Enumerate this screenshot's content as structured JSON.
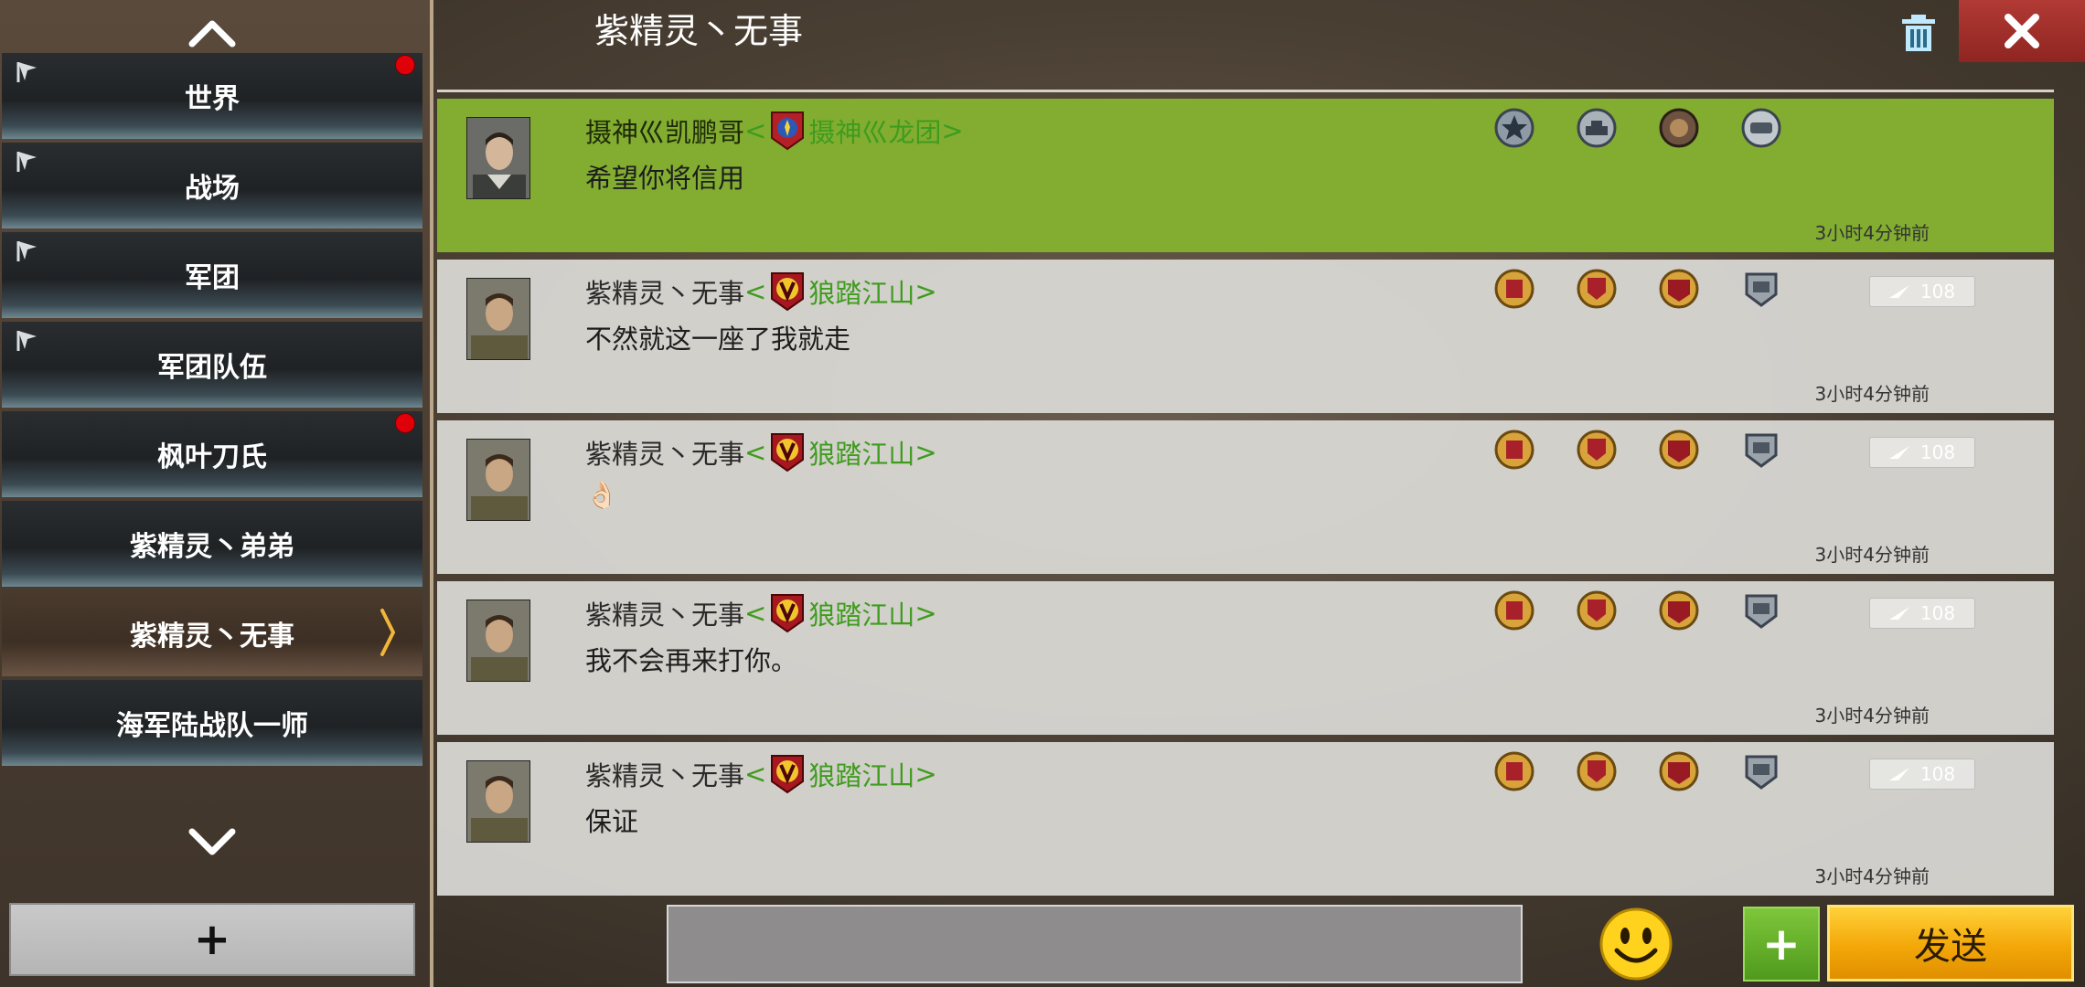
{
  "header": {
    "title": "紫精灵丶无事"
  },
  "sidebar": {
    "channels": [
      {
        "label": "世界",
        "pinned": true,
        "unread": true
      },
      {
        "label": "战场",
        "pinned": true,
        "unread": false
      },
      {
        "label": "军团",
        "pinned": true,
        "unread": false
      },
      {
        "label": "军团队伍",
        "pinned": true,
        "unread": false
      },
      {
        "label": "枫叶刀氏",
        "pinned": false,
        "unread": true
      },
      {
        "label": "紫精灵丶弟弟",
        "pinned": false,
        "unread": false
      },
      {
        "label": "紫精灵丶无事",
        "pinned": false,
        "unread": false,
        "active": true
      },
      {
        "label": "海军陆战队一师",
        "pinned": false,
        "unread": false
      }
    ],
    "add_label": "+"
  },
  "messages": [
    {
      "sender": "摄神巛凯鹏哥",
      "bracket_open": "<",
      "clan": "摄神巛龙团",
      "bracket_close": ">",
      "text": "希望你将信用",
      "time": "3小时4分钟前",
      "highlight": true
    },
    {
      "sender": "紫精灵丶无事",
      "bracket_open": "<",
      "clan": "狼踏江山",
      "bracket_close": ">",
      "text": "不然就这一座了我就走",
      "time": "3小时4分钟前",
      "likes": "108"
    },
    {
      "sender": "紫精灵丶无事",
      "bracket_open": "<",
      "clan": "狼踏江山",
      "bracket_close": ">",
      "text": "👌🏻",
      "time": "3小时4分钟前",
      "likes": "108"
    },
    {
      "sender": "紫精灵丶无事",
      "bracket_open": "<",
      "clan": "狼踏江山",
      "bracket_close": ">",
      "text": "我不会再来打你。",
      "time": "3小时4分钟前",
      "likes": "108"
    },
    {
      "sender": "紫精灵丶无事",
      "bracket_open": "<",
      "clan": "狼踏江山",
      "bracket_close": ">",
      "text": "保证",
      "time": "3小时4分钟前",
      "likes": "108"
    }
  ],
  "composer": {
    "placeholder": "",
    "plus_label": "+",
    "send_label": "发送"
  },
  "colors": {
    "highlight": "#82ad31",
    "clan_green": "#3f9c1e",
    "send_gold": "#f3a708",
    "close_red": "#a0302b"
  }
}
